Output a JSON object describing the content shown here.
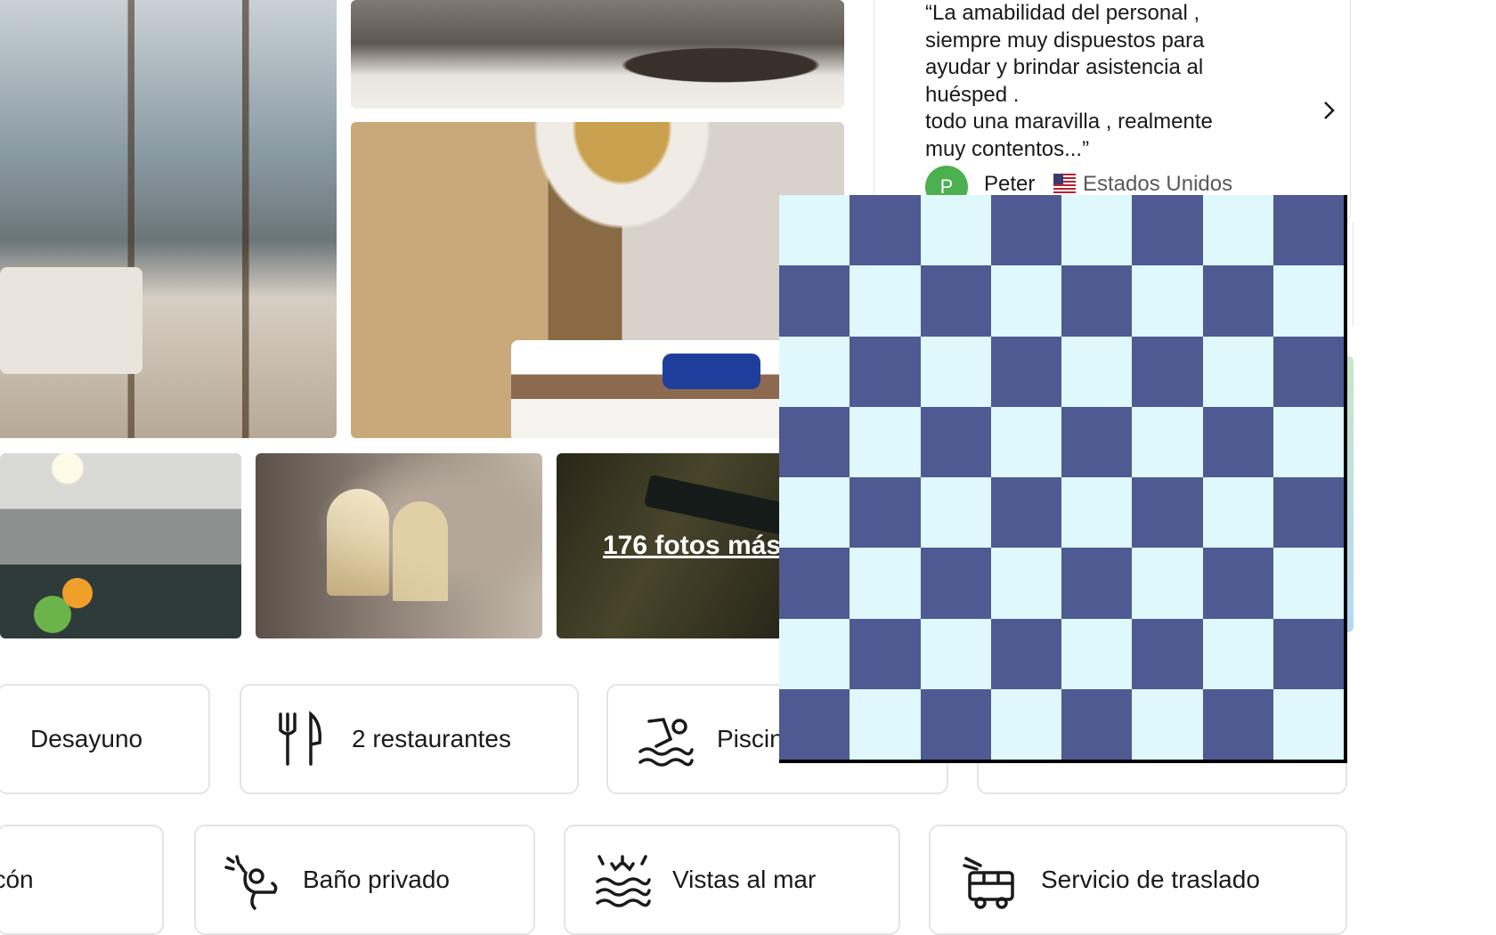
{
  "gallery": {
    "photos": [
      {
        "name": "living-room"
      },
      {
        "name": "butler-service"
      },
      {
        "name": "bedroom"
      },
      {
        "name": "gym"
      },
      {
        "name": "champagne-toast"
      },
      {
        "name": "champagne-bottle"
      }
    ],
    "more_photos_label": "176 fotos más"
  },
  "review": {
    "text": "“La amabilidad del personal ,\nsiempre muy dispuestos para\nayudar y brindar asistencia al\nhuésped .\ntodo una maravilla , realmente\nmuy contentos...”",
    "avatar_initial": "P",
    "author": "Peter",
    "country": "Estados Unidos",
    "next_icon": "chevron-right-icon"
  },
  "features": {
    "row1": [
      {
        "label": "Desayuno",
        "icon": "breakfast-icon"
      },
      {
        "label": "2 restaurantes",
        "icon": "fork-knife-icon"
      },
      {
        "label": "Piscina",
        "icon": "swimming-icon"
      },
      {
        "label": "",
        "icon": ""
      }
    ],
    "row2": [
      {
        "label": "Balcón",
        "icon": "balcony-icon"
      },
      {
        "label": "Baño privado",
        "icon": "shower-icon"
      },
      {
        "label": "Vistas al mar",
        "icon": "sea-view-icon"
      },
      {
        "label": "Servicio de traslado",
        "icon": "shuttle-bus-icon"
      }
    ]
  },
  "overlay": {
    "pattern": "checkerboard",
    "rows": 8,
    "cols": 8,
    "color_dark": "#4f5992",
    "color_light": "#dff8fc",
    "border_color": "#000000"
  }
}
